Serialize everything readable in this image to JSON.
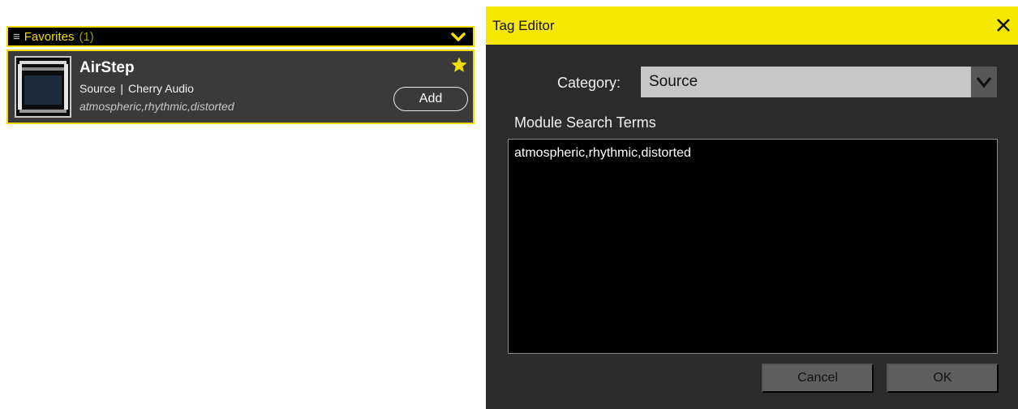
{
  "favorites": {
    "menu_glyph": "≡",
    "title": "Favorites",
    "count": "(1)"
  },
  "module": {
    "name": "AirStep",
    "category": "Source",
    "separator": "|",
    "maker": "Cherry Audio",
    "tags": "atmospheric,rhythmic,distorted",
    "add_label": "Add"
  },
  "tag_editor": {
    "title": "Tag Editor",
    "category_label": "Category:",
    "category_value": "Source",
    "search_terms_label": "Module Search Terms",
    "search_terms_value": "atmospheric,rhythmic,distorted",
    "cancel_label": "Cancel",
    "ok_label": "OK"
  },
  "colors": {
    "accent_yellow": "#f2de00",
    "panel_dark": "#2b2b2b",
    "card_dark": "#3a3a3a"
  },
  "icons": [
    "menu-icon",
    "chevron-down-icon",
    "star-icon",
    "close-icon",
    "select-chevron-icon"
  ]
}
